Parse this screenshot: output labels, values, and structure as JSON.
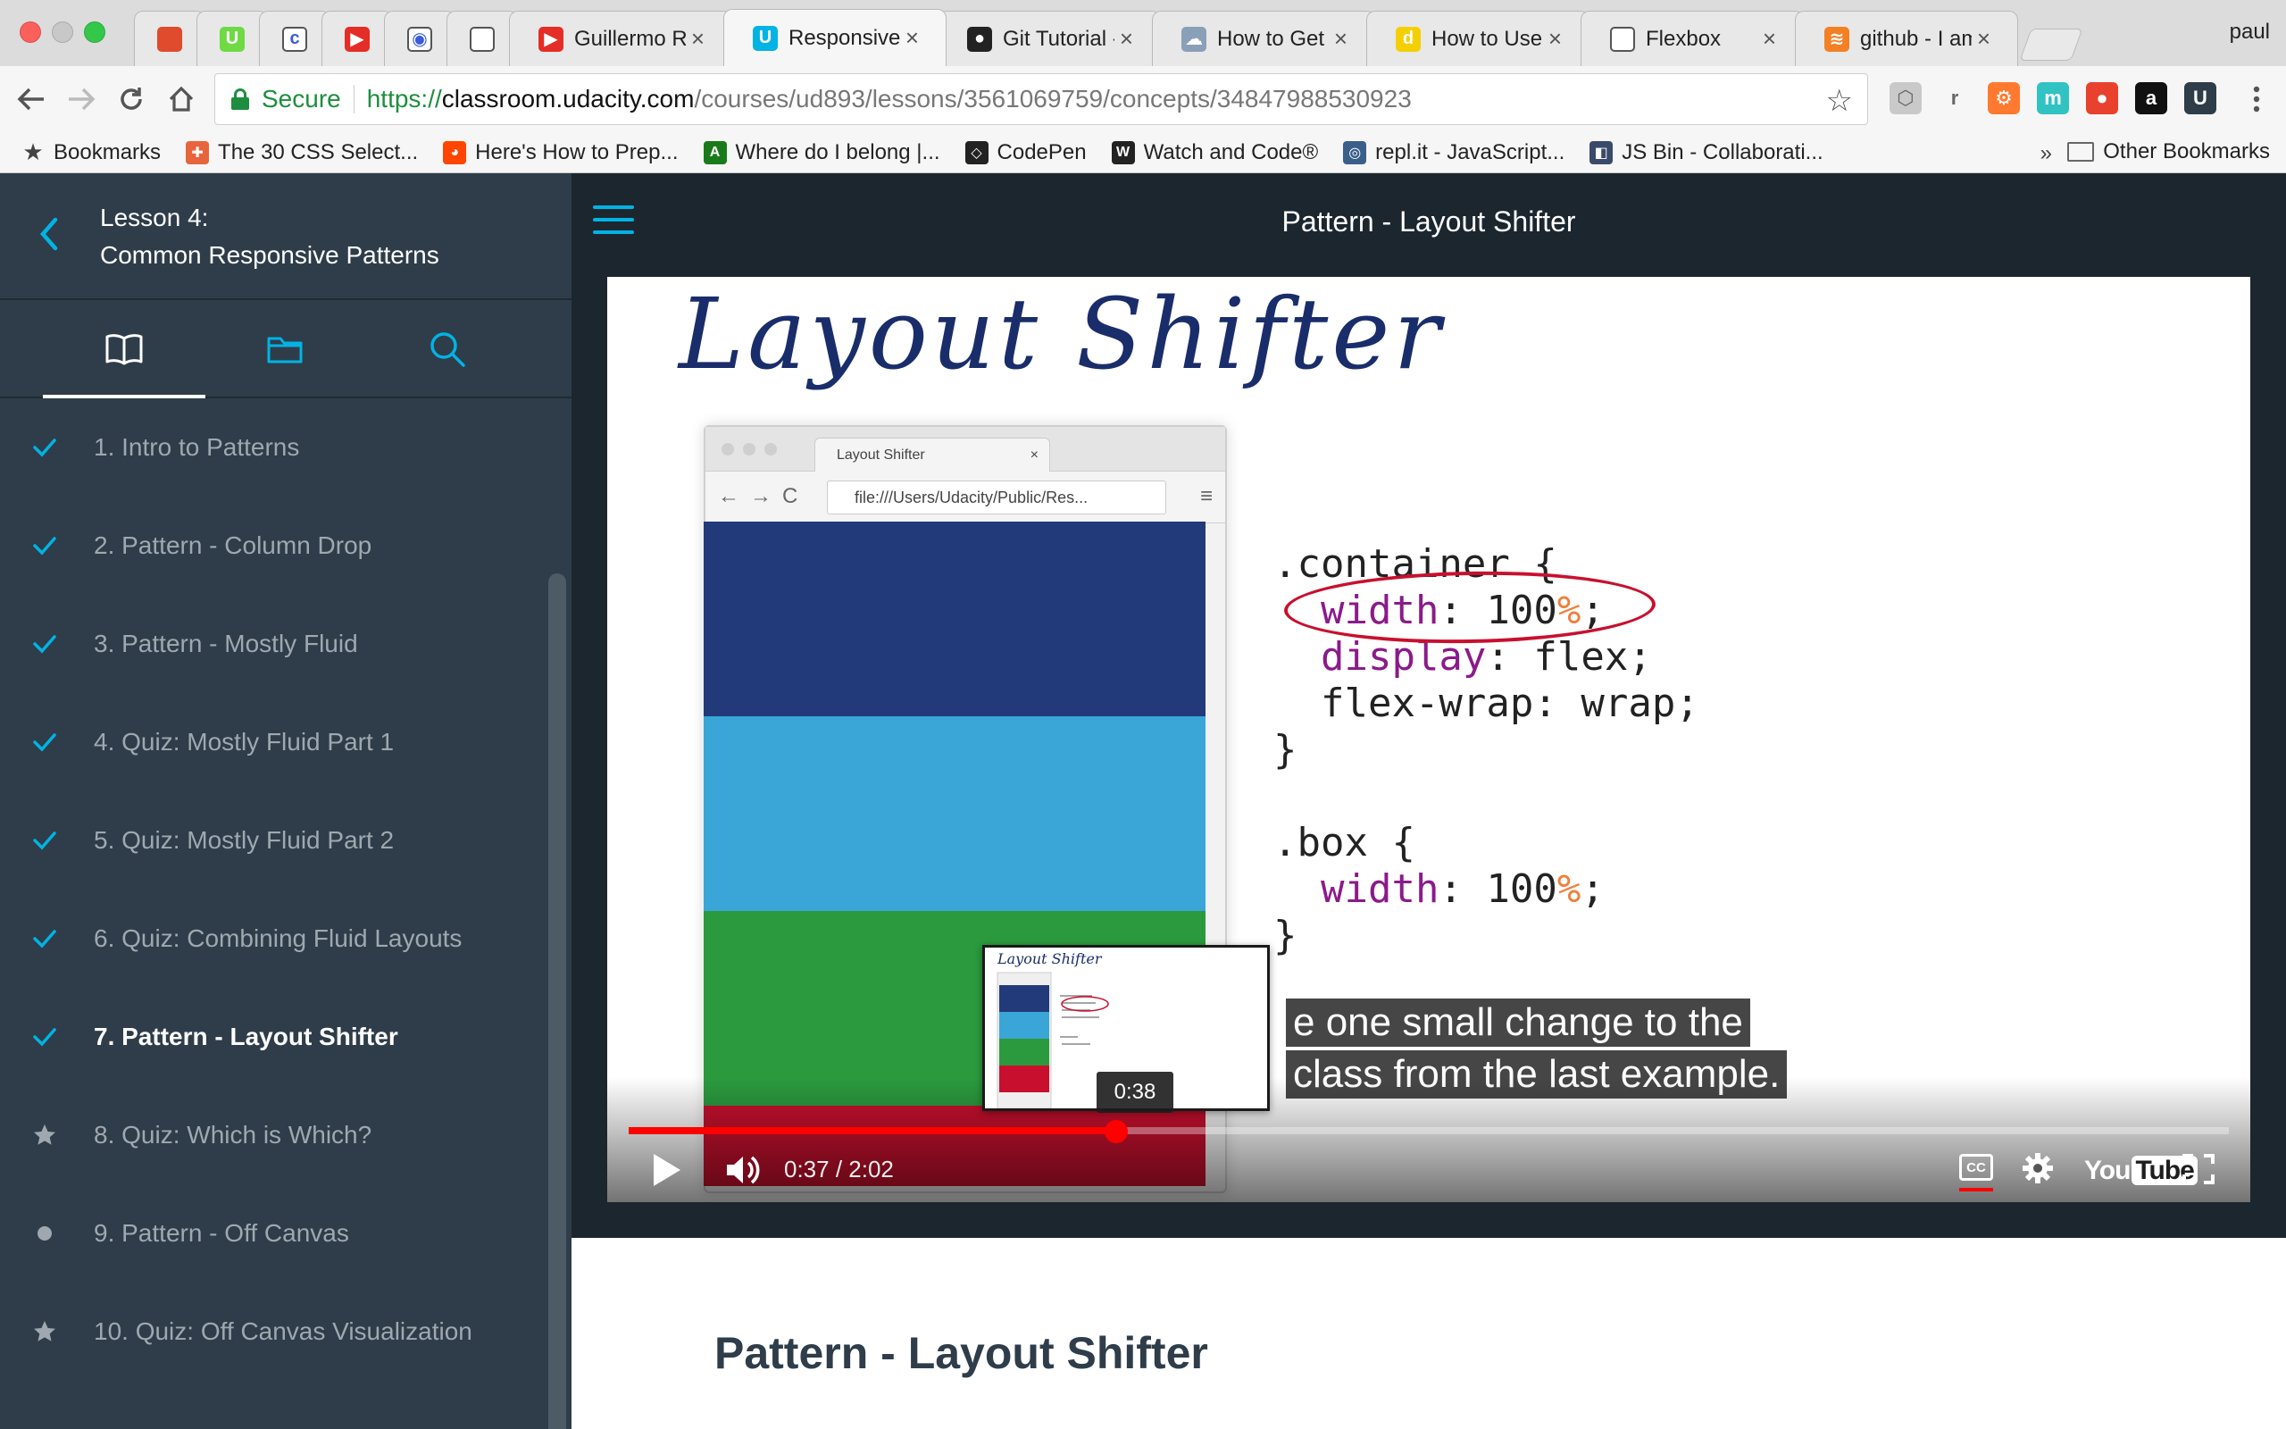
{
  "browser": {
    "tabs": [
      {
        "title": "",
        "icon": "red-avatar-icon",
        "icon_color": "#e04b2d",
        "glyph": ""
      },
      {
        "title": "",
        "icon": "upwork-icon",
        "icon_color": "#6fda44",
        "glyph": "U"
      },
      {
        "title": "",
        "icon": "codecademy-icon",
        "icon_color": "#ffffff",
        "glyph": "c"
      },
      {
        "title": "",
        "icon": "youtube-icon",
        "icon_color": "#e52d27",
        "glyph": "▶"
      },
      {
        "title": "",
        "icon": "camera-icon",
        "icon_color": "#ffffff",
        "glyph": "◉"
      },
      {
        "title": "",
        "icon": "page-icon",
        "icon_color": "#ffffff",
        "glyph": ""
      },
      {
        "title": "Guillermo Ra",
        "icon": "youtube-icon",
        "icon_color": "#e52d27",
        "glyph": "▶"
      },
      {
        "title": "Responsive",
        "icon": "udacity-icon",
        "icon_color": "#02b3e4",
        "glyph": "U",
        "active": true
      },
      {
        "title": "Git Tutorial -",
        "icon": "github-icon",
        "icon_color": "#222222",
        "glyph": "●"
      },
      {
        "title": "How to Get t",
        "icon": "cloud-icon",
        "icon_color": "#8aa0b8",
        "glyph": "☁"
      },
      {
        "title": "How to Use a",
        "icon": "dev-icon",
        "icon_color": "#f4d000",
        "glyph": "d"
      },
      {
        "title": "Flexbox",
        "icon": "page-icon",
        "icon_color": "#ffffff",
        "glyph": ""
      },
      {
        "title": "github - I am",
        "icon": "stackoverflow-icon",
        "icon_color": "#f48024",
        "glyph": "≋"
      }
    ],
    "profile": "paul",
    "address": {
      "secure_label": "Secure",
      "scheme": "https://",
      "host": "classroom.udacity.com",
      "path": "/courses/ud893/lessons/3561069759/concepts/34847988530923"
    },
    "extensions": [
      {
        "icon": "cube-extension-icon",
        "color": "#c9c9c9",
        "glyph": "⬡"
      },
      {
        "icon": "r-extension-icon",
        "color": "#f6f6f6",
        "glyph": "r"
      },
      {
        "icon": "hubspot-extension-icon",
        "color": "#ff7a2f",
        "glyph": "⚙"
      },
      {
        "icon": "m-extension-icon",
        "color": "#31c2c2",
        "glyph": "m"
      },
      {
        "icon": "tomato-extension-icon",
        "color": "#e8412d",
        "glyph": "●"
      },
      {
        "icon": "amazon-extension-icon",
        "color": "#111111",
        "glyph": "a"
      },
      {
        "icon": "udacity-extension-icon",
        "color": "#2e3d49",
        "glyph": "U"
      }
    ],
    "bookmarks": [
      {
        "label": "Bookmarks",
        "icon": "star-icon",
        "color": "#444444",
        "glyph": "★"
      },
      {
        "label": "The 30 CSS Select...",
        "icon": "tutsplus-icon",
        "color": "#e8643c",
        "glyph": "✚"
      },
      {
        "label": "Here's How to Prep...",
        "icon": "reddit-icon",
        "color": "#ff4500",
        "glyph": "◕"
      },
      {
        "label": "Where do I belong |...",
        "icon": "codeup-icon",
        "color": "#1a7a1a",
        "glyph": "A"
      },
      {
        "label": "CodePen",
        "icon": "codepen-icon",
        "color": "#222222",
        "glyph": "◇"
      },
      {
        "label": "Watch and Code®",
        "icon": "watchandcode-icon",
        "color": "#222222",
        "glyph": "W"
      },
      {
        "label": "repl.it - JavaScript...",
        "icon": "replit-icon",
        "color": "#3a5f8a",
        "glyph": "◎"
      },
      {
        "label": "JS Bin - Collaborati...",
        "icon": "jsbin-icon",
        "color": "#3a4a6a",
        "glyph": "◧"
      }
    ],
    "bookmarks_more": "»",
    "other_bookmarks": "Other Bookmarks"
  },
  "sidebar": {
    "lesson_number": "Lesson 4:",
    "lesson_name": "Common Responsive Patterns",
    "concepts": [
      {
        "label": "1. Intro to Patterns",
        "status": "complete"
      },
      {
        "label": "2. Pattern - Column Drop",
        "status": "complete"
      },
      {
        "label": "3. Pattern - Mostly Fluid",
        "status": "complete"
      },
      {
        "label": "4. Quiz: Mostly Fluid Part 1",
        "status": "complete"
      },
      {
        "label": "5. Quiz: Mostly Fluid Part 2",
        "status": "complete"
      },
      {
        "label": "6. Quiz: Combining Fluid Layouts",
        "status": "complete"
      },
      {
        "label": "7. Pattern - Layout Shifter",
        "status": "complete",
        "current": true
      },
      {
        "label": "8. Quiz: Which is Which?",
        "status": "quiz"
      },
      {
        "label": "9. Pattern - Off Canvas",
        "status": "video"
      },
      {
        "label": "10. Quiz: Off Canvas Visualization",
        "status": "quiz"
      }
    ]
  },
  "main": {
    "header_title": "Pattern - Layout Shifter",
    "page_title": "Pattern - Layout Shifter"
  },
  "video": {
    "hand_title": "Layout Shifter",
    "mini_browser": {
      "tab_title": "Layout Shifter",
      "url": "file:///Users/Udacity/Public/Res...",
      "box_colors": [
        "#233a7a",
        "#3aa6d8",
        "#2b9a3e",
        "#c8102e"
      ]
    },
    "code": {
      "line1": ".container {",
      "line2_prop": "width",
      "line2_val": ": 100",
      "line2_pct": "%",
      "line2_end": ";",
      "line3_prop": "display",
      "line3_val": ": flex;",
      "line4": "flex-wrap: wrap;",
      "line5": "}",
      "line6": ".box {",
      "line7_prop": "width",
      "line7_val": ": 100",
      "line7_pct": "%",
      "line7_end": ";",
      "line8": "}"
    },
    "caption_line1": "e one small change to the",
    "caption_line2": "class from the last example.",
    "preview": {
      "time": "0:38"
    },
    "player": {
      "current": "0:37",
      "duration": "2:02",
      "timecode": "0:37 / 2:02",
      "progress": 0.3047,
      "cc_label": "CC",
      "logo_you": "You",
      "logo_tube": "Tube"
    }
  }
}
